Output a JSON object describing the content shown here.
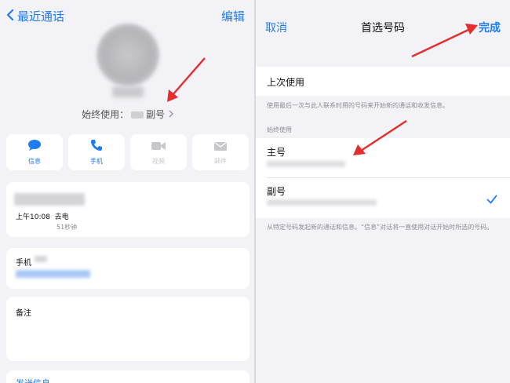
{
  "left": {
    "nav": {
      "back_label": "最近通话",
      "edit_label": "编辑"
    },
    "always_use": {
      "label": "始终使用：",
      "line": "副号"
    },
    "actions": [
      {
        "label": "信息",
        "icon": "message-bubble-icon"
      },
      {
        "label": "手机",
        "icon": "phone-icon"
      },
      {
        "label": "视频",
        "icon": "video-icon"
      },
      {
        "label": "邮件",
        "icon": "mail-icon"
      }
    ],
    "call": {
      "time": "上午10:08",
      "type": "去电",
      "duration": "51秒钟"
    },
    "phone": {
      "label": "手机"
    },
    "notes": {
      "label": "备注"
    },
    "bottom_partial": "发送信息"
  },
  "right": {
    "cancel_label": "取消",
    "title": "首选号码",
    "done_label": "完成",
    "last_used_label": "上次使用",
    "last_used_note": "使用最后一次与此人联系时用的号码来开始新的通话和收发信息。",
    "section_header": "始终使用",
    "primary_label": "主号",
    "secondary_label": "副号",
    "footer_note": "从特定号码发起新的通话和信息。“信息”对话将一直使用对话开始时所选的号码。"
  },
  "colors": {
    "accent": "#1e7cf2",
    "annotation_arrow": "#e52d2d"
  }
}
